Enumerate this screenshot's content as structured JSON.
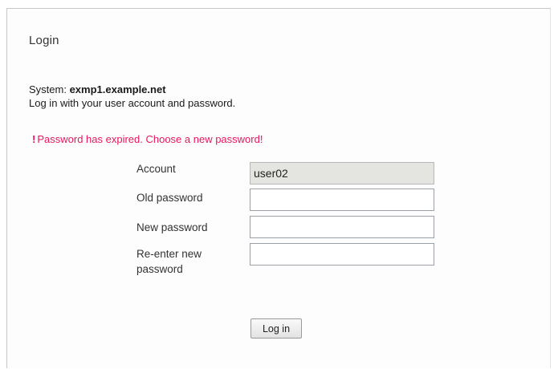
{
  "login": {
    "title": "Login",
    "system_prefix": "System: ",
    "system_name": "exmp1.example.net",
    "intro": "Log in with your user account and password.",
    "error_icon": "!",
    "error_message": "Password has expired. Choose a new password!",
    "error_color": "#e8175d",
    "fields": {
      "account_label": "Account",
      "account_value": "user02",
      "old_password_label": "Old password",
      "old_password_value": "",
      "new_password_label": "New password",
      "new_password_value": "",
      "reenter_label_line1": "Re-enter new",
      "reenter_label_line2": "password",
      "reenter_value": ""
    },
    "button_label": "Log in"
  }
}
